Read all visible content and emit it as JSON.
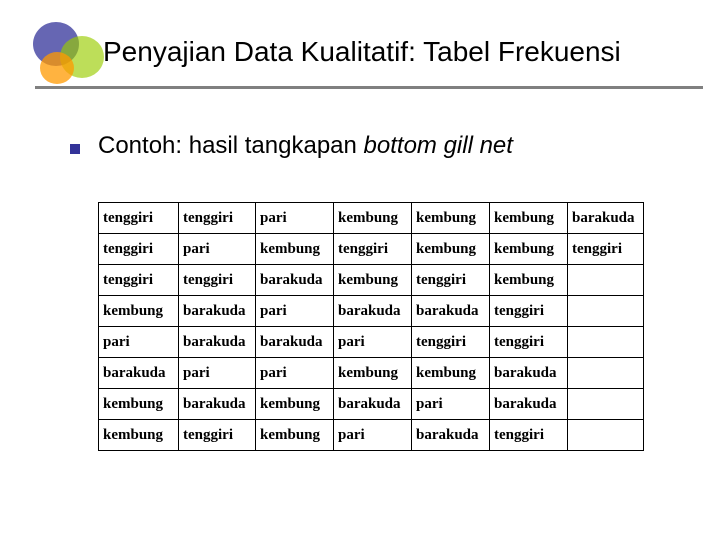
{
  "title": "Penyajian Data Kualitatif: Tabel Frekuensi",
  "bullet_prefix": "Contoh: hasil tangkapan ",
  "bullet_italic": "bottom gill net",
  "table": {
    "rows": [
      [
        "tenggiri",
        "tenggiri",
        "pari",
        "kembung",
        "kembung",
        "kembung",
        "barakuda"
      ],
      [
        "tenggiri",
        "pari",
        "kembung",
        "tenggiri",
        "kembung",
        "kembung",
        "tenggiri"
      ],
      [
        "tenggiri",
        "tenggiri",
        "barakuda",
        "kembung",
        "tenggiri",
        "kembung",
        ""
      ],
      [
        "kembung",
        "barakuda",
        "pari",
        "barakuda",
        "barakuda",
        "tenggiri",
        ""
      ],
      [
        "pari",
        "barakuda",
        "barakuda",
        "pari",
        "tenggiri",
        "tenggiri",
        ""
      ],
      [
        "barakuda",
        "pari",
        "pari",
        "kembung",
        "kembung",
        "barakuda",
        ""
      ],
      [
        "kembung",
        "barakuda",
        "kembung",
        "barakuda",
        "pari",
        "barakuda",
        ""
      ],
      [
        "kembung",
        "tenggiri",
        "kembung",
        "pari",
        "barakuda",
        "tenggiri",
        ""
      ]
    ]
  }
}
